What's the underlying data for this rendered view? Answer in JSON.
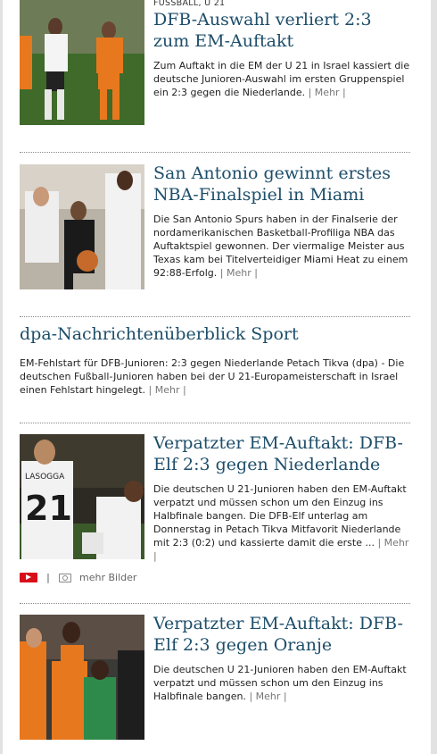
{
  "articles": [
    {
      "kicker": "FUSSBALL, U 21",
      "headline": "DFB-Auswahl verliert 2:3 zum EM-Auftakt",
      "teaser": "Zum Auftakt in die EM der U 21 in Israel kassiert die deutsche Junioren-Auswahl im ersten Gruppenspiel ein 2:3 gegen die Niederlande.",
      "more": "| Mehr |"
    },
    {
      "headline": "San Antonio gewinnt erstes NBA-Finalspiel in Miami",
      "teaser": "Die San Antonio Spurs haben in der Finalserie der nordamerikanischen Basketball-Profiliga NBA das Auftaktspiel gewonnen. Der viermalige Meister aus Texas kam bei Titelverteidiger Miami Heat zu einem 92:88-Erfolg.",
      "more": "| Mehr |"
    },
    {
      "headline": "dpa-Nachrichtenüberblick Sport",
      "teaser": "EM-Fehlstart für DFB-Junioren: 2:3 gegen Niederlande Petach Tikva (dpa) - Die deutschen Fußball-Junioren haben bei der U 21-Europameisterschaft in Israel einen Fehlstart hingelegt.",
      "more": "| Mehr |"
    },
    {
      "headline": "Verpatzter EM-Auftakt: DFB-Elf 2:3 gegen Niederlande",
      "teaser": "Die deutschen U 21-Junioren haben den EM-Auftakt verpatzt und müssen schon um den Einzug ins Halbfinale bangen. Die DFB-Elf unterlag am Donnerstag in Petach Tikva Mitfavorit Niederlande mit 2:3 (0:2) und kassierte damit die erste ...",
      "more": "| Mehr |",
      "video_pipe": "|",
      "more_pictures": "mehr Bilder",
      "photo_number": "21",
      "photo_name": "LASOGGA"
    },
    {
      "headline": "Verpatzter EM-Auftakt: DFB-Elf 2:3 gegen Oranje",
      "teaser": "Die deutschen U 21-Junioren haben den EM-Auftakt verpatzt und müssen schon um den Einzug ins Halbfinale bangen.",
      "more": "| Mehr |"
    }
  ],
  "colors": {
    "headline": "#1d4e6a",
    "video": "#d80f1b"
  }
}
